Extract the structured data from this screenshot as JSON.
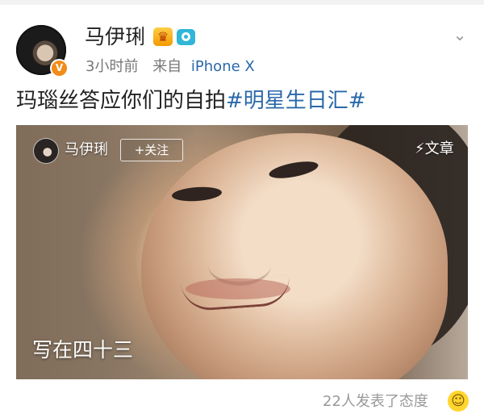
{
  "user": {
    "name": "马伊琍",
    "verified_mark": "V",
    "badge_crown": "♛",
    "badge_camera": "camera-icon"
  },
  "post": {
    "time": "3小时前",
    "from": "来自",
    "device": "iPhone X",
    "text": "玛瑙丝答应你们的自拍",
    "hashtag": "#明星生日汇#"
  },
  "article_card": {
    "author_name": "马伊琍",
    "follow_label": "+关注",
    "article_label": "⚡文章",
    "title": "写在四十三"
  },
  "footer": {
    "reaction_text": "22人发表了态度",
    "emoji": "☺"
  },
  "colors": {
    "link": "#2a68a8",
    "secondary_text": "#777777",
    "badge_orange": "#f28b1a",
    "camera_blue": "#2fb6d8"
  }
}
